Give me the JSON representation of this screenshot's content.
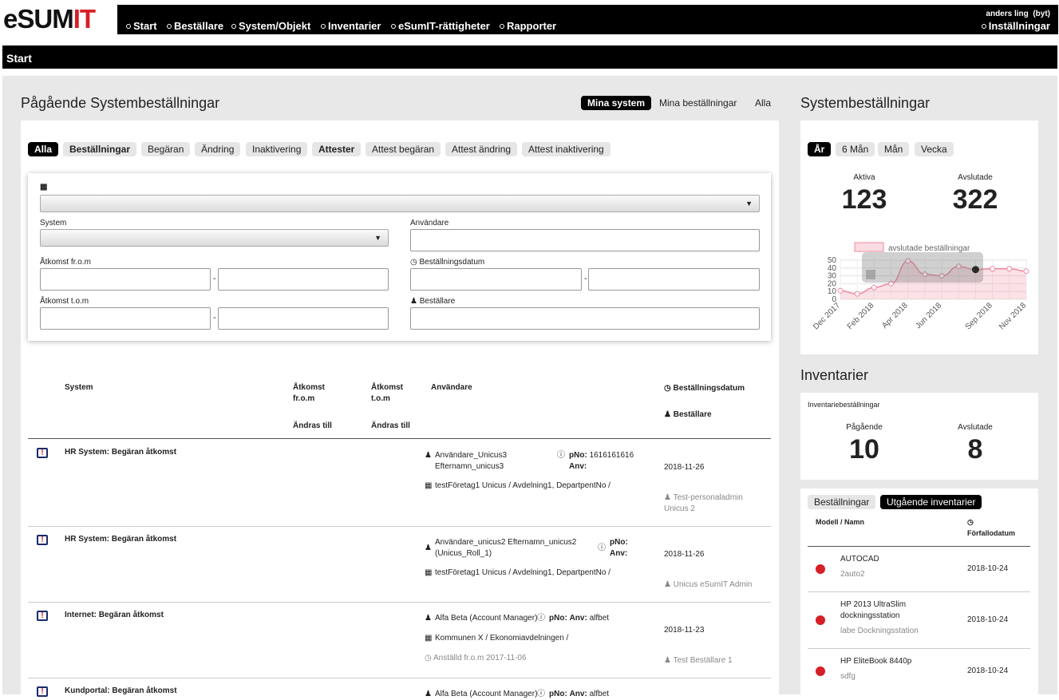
{
  "logo": {
    "e": "e",
    "sum": "SUM",
    "it": "IT"
  },
  "nav": {
    "items": [
      "Start",
      "Beställare",
      "System/Objekt",
      "Inventarier",
      "eSumIT-rättigheter",
      "Rapporter"
    ],
    "user": "anders ling",
    "switch": "(byt)",
    "settings": "Inställningar"
  },
  "breadcrumb": "Start",
  "orders": {
    "title": "Pågående Systembeställningar",
    "scope_tabs": [
      "Mina system",
      "Mina beställningar",
      "Alla"
    ],
    "filter_tabs": [
      "Alla",
      "Beställningar",
      "Begäran",
      "Ändring",
      "Inaktivering",
      "Attester",
      "Attest begäran",
      "Attest ändring",
      "Attest inaktivering"
    ],
    "form": {
      "org_icon": "building-icon",
      "system_label": "System",
      "user_label": "Användare",
      "access_from_label": "Åtkomst fr.o.m",
      "order_date_label": "Beställningsdatum",
      "access_to_label": "Åtkomst t.o.m",
      "orderer_label": "Beställare",
      "dash": "-"
    },
    "table": {
      "headers": {
        "system": "System",
        "access_from": "Åtkomst fr.o.m",
        "access_to": "Åtkomst t.o.m",
        "changes_to": "Ändras till",
        "user": "Användare",
        "order_date": "Beställningsdatum",
        "orderer": "Beställare"
      },
      "rows": [
        {
          "title": "HR System: Begäran åtkomst",
          "user": "Användare_Unicus3",
          "user2": "Efternamn_unicus3",
          "pno": "pNo:",
          "pno_val": "1616161616",
          "anv": "Anv:",
          "org": "testFöretag1 Unicus / Avdelning1, DepartpentNo /",
          "date": "2018-11-26",
          "orderer": "Test-personaladmin",
          "orderer2": "Unicus 2"
        },
        {
          "title": "HR System: Begäran åtkomst",
          "user": "Användare_unicus2 Efternamn_unicus2",
          "user2": "(Unicus_Roll_1)",
          "pno": "pNo:",
          "pno_val": "",
          "anv": "Anv:",
          "org": "testFöretag1 Unicus / Avdelning1, DepartpentNo /",
          "date": "2018-11-26",
          "orderer": "Unicus eSumIT Admin"
        },
        {
          "title": "Internet: Begäran åtkomst",
          "user": "Alfa Beta (Account Manager)",
          "pno": "pNo:",
          "anv": "Anv:",
          "anv_val": "alfbet",
          "org": "Kommunen X / Ekonomiavdelningen /",
          "employed": "Anställd fr.o.m 2017-11-06",
          "date": "2018-11-23",
          "orderer": "Test Beställare 1"
        },
        {
          "title": "Kundportal: Begäran åtkomst",
          "user": "Alfa Beta (Account Manager)",
          "pno": "pNo:",
          "anv": "Anv:",
          "anv_val": "alfbet"
        }
      ]
    }
  },
  "sysorders": {
    "title": "Systembeställningar",
    "periods": [
      "År",
      "6 Mån",
      "Mån",
      "Vecka"
    ],
    "active_label": "Aktiva",
    "active_value": "123",
    "closed_label": "Avslutade",
    "closed_value": "322"
  },
  "chart_data": {
    "type": "area",
    "legend": "avslutade beställningar",
    "x": [
      "Dec 2017",
      "Jan 2018",
      "Feb 2018",
      "Mar 2018",
      "Apr 2018",
      "May 2018",
      "Jun 2018",
      "Jul 2018",
      "Aug 2018",
      "Sep 2018",
      "Oct 2018",
      "Nov 2018"
    ],
    "x_tick_labels": [
      "Dec 2017",
      "Feb 2018",
      "Apr 2018",
      "Jun 2018",
      "Sep 2018",
      "Nov 2018"
    ],
    "values": [
      11,
      7,
      15,
      20,
      49,
      32,
      30,
      42,
      38,
      39,
      39,
      36
    ],
    "highlight_index": 8,
    "yticks": [
      0,
      10,
      20,
      30,
      40,
      50
    ],
    "ylim": [
      0,
      52
    ],
    "color": "#f08aa0"
  },
  "inventory": {
    "title": "Inventarier",
    "card_title": "Inventariebeställningar",
    "ongoing_label": "Pågående",
    "ongoing_value": "10",
    "closed_label": "Avslutade",
    "closed_value": "8",
    "tabs": [
      "Beställningar",
      "Utgående inventarier"
    ],
    "col_model": "Modell / Namn",
    "col_due": "Förfallodatum",
    "items": [
      {
        "name": "AUTOCAD",
        "sub": "2auto2",
        "date": "2018-10-24"
      },
      {
        "name": "HP 2013 UltraSlim",
        "name2": "dockningsstation",
        "sub": "labe Dockningsstation",
        "date": "2018-10-24"
      },
      {
        "name": "HP EliteBook 8440p",
        "sub": "sdfg",
        "date": "2018-10-24"
      }
    ]
  }
}
